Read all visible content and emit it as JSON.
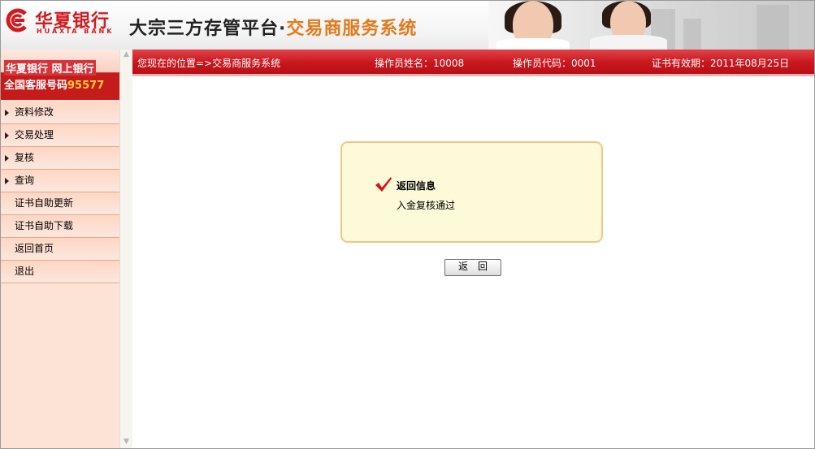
{
  "header": {
    "logo_cn": "华夏银行",
    "logo_en": "HUAXIA BANK",
    "title_main": "大宗三方存管平台",
    "title_dot": "·",
    "title_sub": "交易商服务系统"
  },
  "promo": {
    "line1": "华夏银行 网上银行",
    "line2_prefix": "全国客服号码",
    "line2_number": "95577"
  },
  "sidebar": {
    "items": [
      {
        "label": "资料修改",
        "expandable": true
      },
      {
        "label": "交易处理",
        "expandable": true
      },
      {
        "label": "复核",
        "expandable": true
      },
      {
        "label": "查询",
        "expandable": true
      },
      {
        "label": "证书自助更新",
        "expandable": false
      },
      {
        "label": "证书自助下载",
        "expandable": false
      },
      {
        "label": "返回首页",
        "expandable": false
      },
      {
        "label": "退出",
        "expandable": false
      }
    ]
  },
  "topbar": {
    "location": "您现在的位置=>交易商服务系统",
    "operator_name": "操作员姓名：10008",
    "operator_code": "操作员代码：0001",
    "cert_expiry": "证书有效期：2011年08月25日"
  },
  "message": {
    "title": "返回信息",
    "text": "入金复核通过",
    "icon": "checkmark-icon"
  },
  "actions": {
    "back_label": "返回"
  },
  "colors": {
    "brand_red": "#c8161d",
    "accent_orange": "#e57a1c",
    "sidebar_bg": "#fde3d6",
    "message_bg": "#fcfad8",
    "message_border": "#f5c48b"
  }
}
